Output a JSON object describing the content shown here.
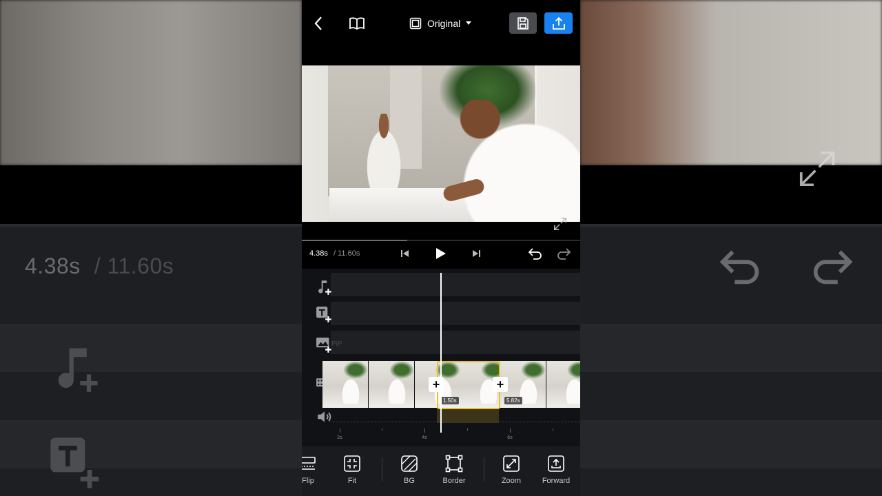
{
  "background": {
    "current_time": "4.38s",
    "total_time": "/ 11.60s"
  },
  "topbar": {
    "aspect_ratio_label": "Original"
  },
  "playback": {
    "current_time": "4.38s",
    "total_time": "/ 11.60s",
    "progress_fraction": 0.3776
  },
  "timeline": {
    "tracks": [
      {
        "name": "music",
        "icon": "music-add-icon"
      },
      {
        "name": "text",
        "icon": "text-add-icon"
      },
      {
        "name": "pip",
        "icon": "image-add-icon",
        "label": "PiP"
      },
      {
        "name": "video",
        "icon": "video-add-icon"
      },
      {
        "name": "audio",
        "icon": "volume-icon"
      }
    ],
    "clip_durations": [
      "1.50s",
      "5.82s"
    ],
    "ruler_labels": [
      "2s",
      "4s",
      "6s"
    ]
  },
  "toolbar": {
    "items": [
      {
        "label": "Flip",
        "icon": "flip-icon"
      },
      {
        "label": "Fit",
        "icon": "fit-icon"
      },
      {
        "label": "BG",
        "icon": "bg-icon"
      },
      {
        "label": "Border",
        "icon": "border-icon"
      },
      {
        "label": "Zoom",
        "icon": "zoom-icon"
      },
      {
        "label": "Forward",
        "icon": "forward-icon"
      }
    ]
  },
  "colors": {
    "accent_blue": "#1a82f0",
    "selection_yellow": "#f0c020",
    "panel": "#1a1b1e"
  }
}
